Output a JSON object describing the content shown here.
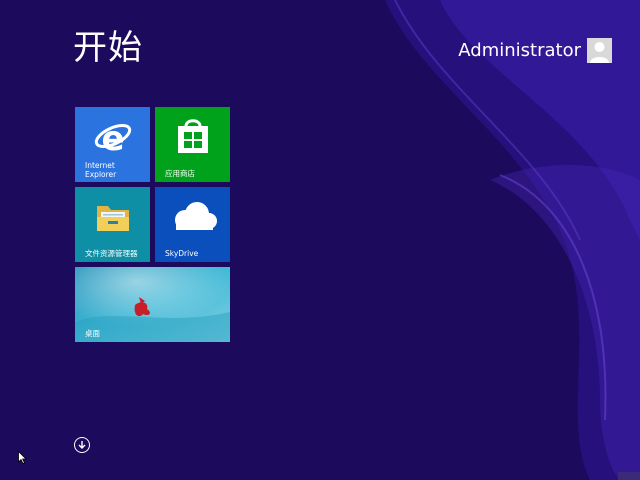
{
  "start": {
    "title": "开始"
  },
  "user": {
    "name": "Administrator",
    "avatar_icon": "user-silhouette-icon"
  },
  "tiles": [
    {
      "label_line1": "Internet",
      "label_line2": "Explorer",
      "icon": "internet-explorer-icon",
      "color": "#2b74e0"
    },
    {
      "label": "应用商店",
      "icon": "store-bag-icon",
      "color": "#00a21b"
    },
    {
      "label": "文件资源管理器",
      "icon": "folder-icon",
      "color": "#0f8fa5"
    },
    {
      "label": "SkyDrive",
      "icon": "cloud-icon",
      "color": "#0b4fbd"
    },
    {
      "label": "桌面",
      "icon": "desktop-wallpaper",
      "color": "#2da7c7"
    }
  ],
  "apps_button": {
    "icon": "arrow-down-circle-icon"
  },
  "colors": {
    "background": "#1c0a5c",
    "swirl": "#3b1fa0"
  }
}
